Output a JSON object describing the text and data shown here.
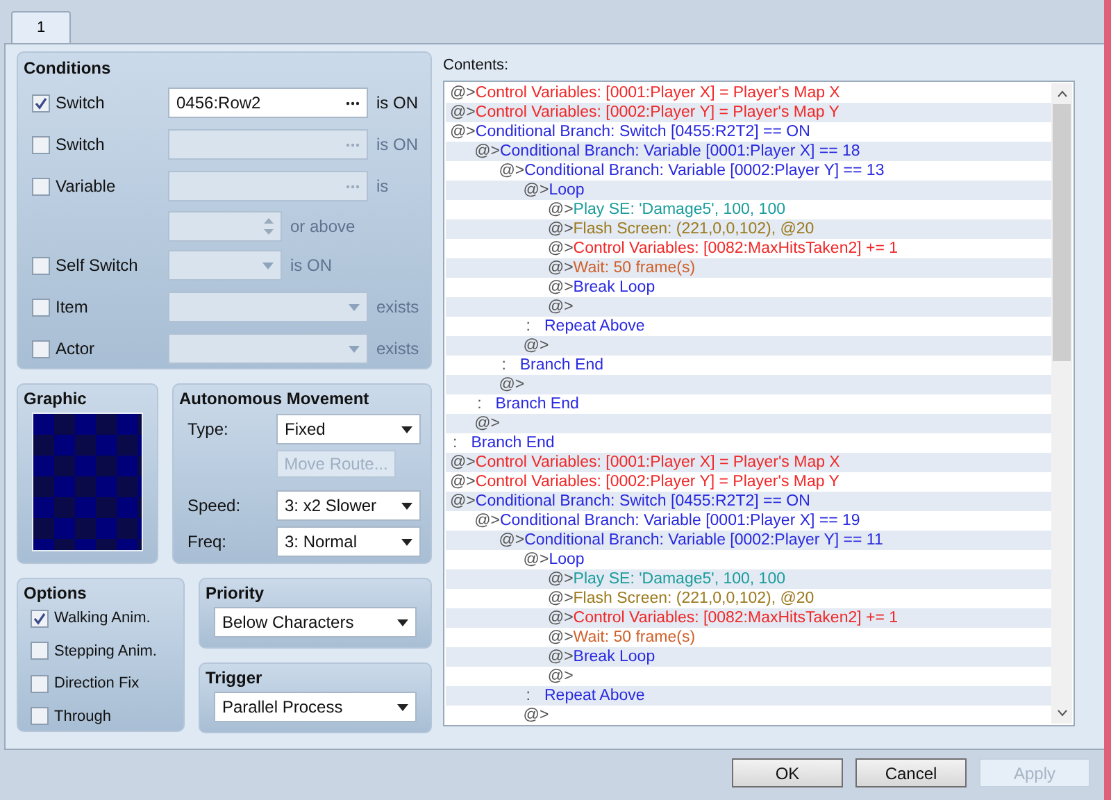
{
  "tabs": [
    {
      "label": "1",
      "selected": true
    }
  ],
  "conditions": {
    "title": "Conditions",
    "rows": [
      {
        "kind": "picker",
        "label": "Switch",
        "checked": true,
        "value": "0456:Row2",
        "suffix": "is ON"
      },
      {
        "kind": "picker",
        "label": "Switch",
        "checked": false,
        "suffix": "is ON"
      },
      {
        "kind": "picker",
        "label": "Variable",
        "checked": false,
        "suffix": "is"
      },
      {
        "kind": "spin",
        "disabled": true,
        "suffix": "or above"
      },
      {
        "kind": "dropdown",
        "label": "Self Switch",
        "checked": false,
        "suffix": "is ON"
      },
      {
        "kind": "wide_dropdown",
        "label": "Item",
        "checked": false,
        "suffix": "exists"
      },
      {
        "kind": "wide_dropdown",
        "label": "Actor",
        "checked": false,
        "suffix": "exists"
      }
    ]
  },
  "graphic": {
    "title": "Graphic"
  },
  "movement": {
    "title": "Autonomous Movement",
    "fields": [
      {
        "kind": "dropdown",
        "label": "Type:",
        "value": "Fixed"
      },
      {
        "kind": "button",
        "label": "Move Route...",
        "disabled": true
      },
      {
        "kind": "dropdown",
        "label": "Speed:",
        "value": "3: x2 Slower"
      },
      {
        "kind": "dropdown",
        "label": "Freq:",
        "value": "3: Normal"
      }
    ]
  },
  "options": {
    "title": "Options",
    "items": [
      {
        "label": "Walking Anim.",
        "checked": true
      },
      {
        "label": "Stepping Anim.",
        "checked": false
      },
      {
        "label": "Direction Fix",
        "checked": false
      },
      {
        "label": "Through",
        "checked": false
      }
    ]
  },
  "priority": {
    "title": "Priority",
    "value": "Below Characters"
  },
  "trigger": {
    "title": "Trigger",
    "value": "Parallel Process"
  },
  "contents": {
    "label": "Contents:",
    "lines": [
      {
        "prefix": "@>",
        "text": "Control Variables: [0001:Player X] = Player's Map X",
        "kind": "variable"
      },
      {
        "prefix": "@>",
        "text": "Control Variables: [0002:Player Y] = Player's Map Y",
        "kind": "variable"
      },
      {
        "prefix": "@>",
        "text": "Conditional Branch: Switch [0455:R2T2] == ON",
        "kind": "flow",
        "children": [
          {
            "prefix": "@>",
            "text": "Conditional Branch: Variable [0001:Player X] == 18",
            "kind": "flow",
            "children": [
              {
                "prefix": "@>",
                "text": "Conditional Branch: Variable [0002:Player Y] == 13",
                "kind": "flow",
                "children": [
                  {
                    "prefix": "@>",
                    "text": "Loop",
                    "kind": "flow",
                    "children": [
                      {
                        "prefix": "@>",
                        "text": "Play SE: 'Damage5', 100, 100",
                        "kind": "sound"
                      },
                      {
                        "prefix": "@>",
                        "text": "Flash Screen: (221,0,0,102), @20",
                        "kind": "screen"
                      },
                      {
                        "prefix": "@>",
                        "text": "Control Variables: [0082:MaxHitsTaken2] += 1",
                        "kind": "variable"
                      },
                      {
                        "prefix": "@>",
                        "text": "Wait: 50 frame(s)",
                        "kind": "wait"
                      },
                      {
                        "prefix": "@>",
                        "text": "Break Loop",
                        "kind": "flow"
                      },
                      {
                        "prefix": "@>"
                      }
                    ]
                  },
                  {
                    "prefix": ":",
                    "text": "Repeat Above",
                    "kind": "flow"
                  },
                  {
                    "prefix": "@>"
                  }
                ]
              },
              {
                "prefix": ":",
                "text": "Branch End",
                "kind": "flow"
              },
              {
                "prefix": "@>"
              }
            ]
          },
          {
            "prefix": ":",
            "text": "Branch End",
            "kind": "flow"
          },
          {
            "prefix": "@>"
          }
        ]
      },
      {
        "prefix": ":",
        "text": "Branch End",
        "kind": "flow"
      },
      {
        "prefix": "@>",
        "text": "Control Variables: [0001:Player X] = Player's Map X",
        "kind": "variable"
      },
      {
        "prefix": "@>",
        "text": "Control Variables: [0002:Player Y] = Player's Map Y",
        "kind": "variable"
      },
      {
        "prefix": "@>",
        "text": "Conditional Branch: Switch [0455:R2T2] == ON",
        "kind": "flow",
        "children": [
          {
            "prefix": "@>",
            "text": "Conditional Branch: Variable [0001:Player X] == 19",
            "kind": "flow",
            "children": [
              {
                "prefix": "@>",
                "text": "Conditional Branch: Variable [0002:Player Y] == 11",
                "kind": "flow",
                "children": [
                  {
                    "prefix": "@>",
                    "text": "Loop",
                    "kind": "flow",
                    "children": [
                      {
                        "prefix": "@>",
                        "text": "Play SE: 'Damage5', 100, 100",
                        "kind": "sound"
                      },
                      {
                        "prefix": "@>",
                        "text": "Flash Screen: (221,0,0,102), @20",
                        "kind": "screen"
                      },
                      {
                        "prefix": "@>",
                        "text": "Control Variables: [0082:MaxHitsTaken2] += 1",
                        "kind": "variable"
                      },
                      {
                        "prefix": "@>",
                        "text": "Wait: 50 frame(s)",
                        "kind": "wait"
                      },
                      {
                        "prefix": "@>",
                        "text": "Break Loop",
                        "kind": "flow"
                      },
                      {
                        "prefix": "@>"
                      }
                    ]
                  },
                  {
                    "prefix": ":",
                    "text": "Repeat Above",
                    "kind": "flow"
                  },
                  {
                    "prefix": "@>"
                  }
                ]
              }
            ]
          }
        ]
      }
    ]
  },
  "buttons": [
    {
      "label": "OK",
      "disabled": false
    },
    {
      "label": "Cancel",
      "disabled": false
    },
    {
      "label": "Apply",
      "disabled": true
    }
  ]
}
